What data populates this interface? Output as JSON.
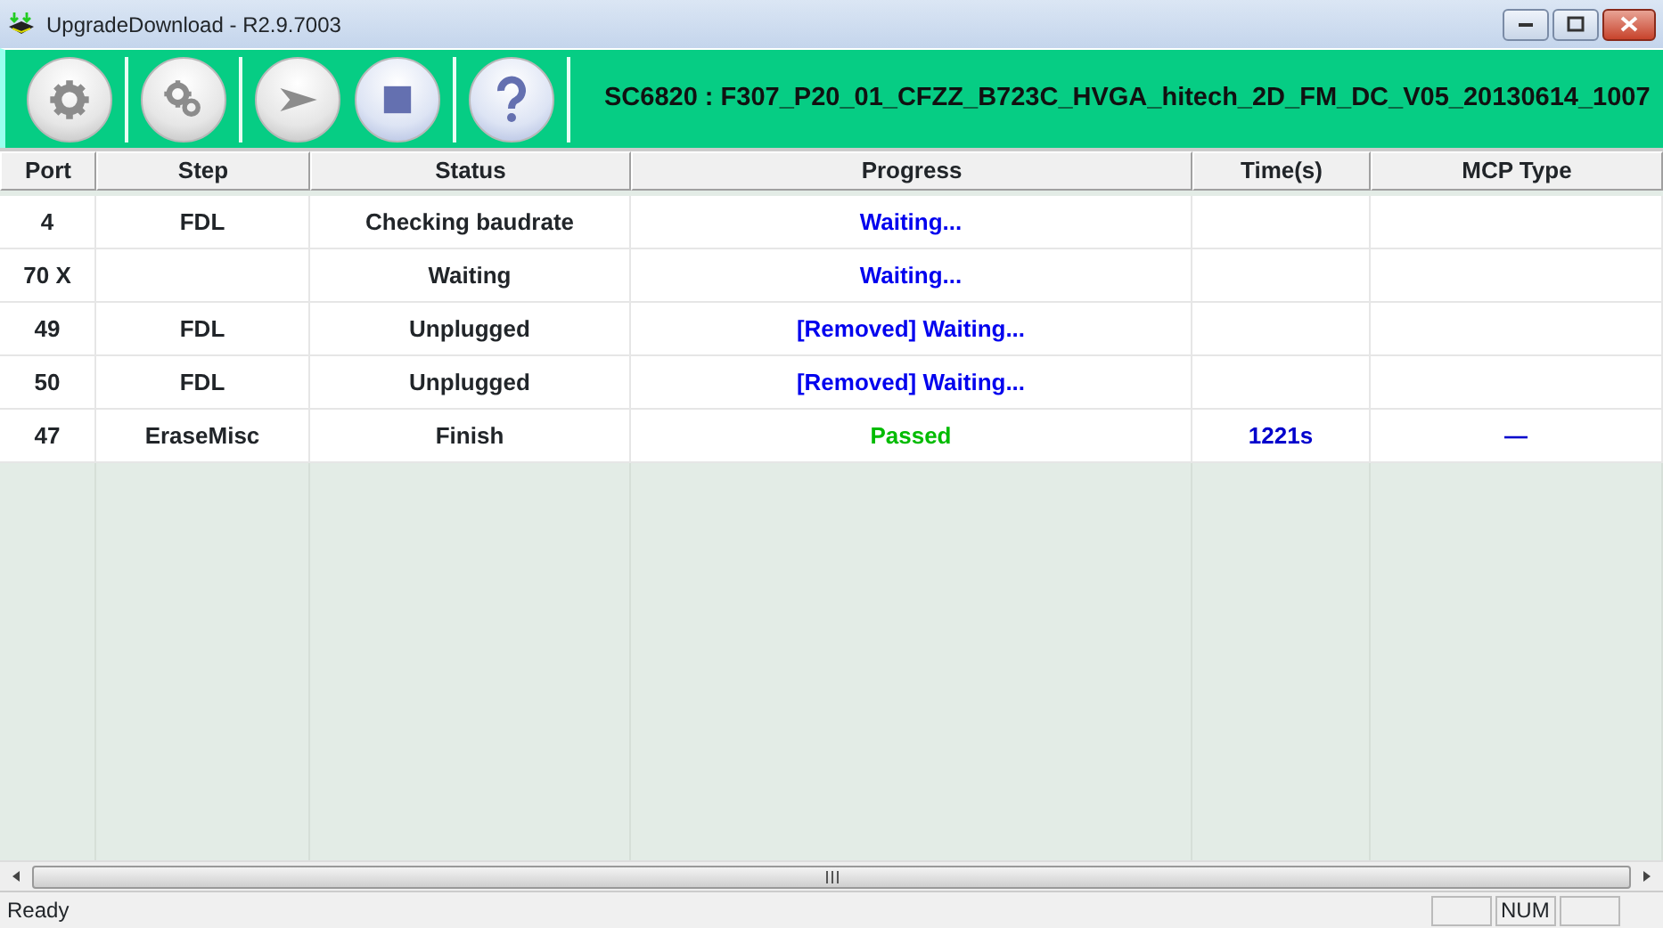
{
  "window": {
    "title": "UpgradeDownload - R2.9.7003"
  },
  "toolbar": {
    "buttons": [
      {
        "kind": "gear",
        "disabled": true
      },
      {
        "kind": "gears",
        "disabled": true
      },
      {
        "kind": "play",
        "disabled": true
      },
      {
        "kind": "stop",
        "disabled": false
      },
      {
        "kind": "help",
        "disabled": false
      }
    ],
    "firmware": "SC6820 : F307_P20_01_CFZZ_B723C_HVGA_hitech_2D_FM_DC_V05_20130614_1007"
  },
  "table": {
    "columns": [
      "Port",
      "Step",
      "Status",
      "Progress",
      "Time(s)",
      "MCP Type"
    ],
    "rows": [
      {
        "port": "4",
        "step": "FDL",
        "status": "Checking baudrate",
        "progress": {
          "text": "Waiting...",
          "color": "#0000ee"
        }
      },
      {
        "port": "70 X",
        "status": "Waiting",
        "progress": {
          "text": "Waiting...",
          "color": "#0000ee"
        }
      },
      {
        "port": "49",
        "step": "FDL",
        "status": "Unplugged",
        "progress": {
          "text": "[Removed] Waiting...",
          "color": "#0000ee"
        }
      },
      {
        "port": "50",
        "step": "FDL",
        "status": "Unplugged",
        "progress": {
          "text": "[Removed] Waiting...",
          "color": "#0000ee"
        }
      },
      {
        "port": "47",
        "step": "EraseMisc",
        "status": "Finish",
        "progress": {
          "text": "Passed",
          "color": "#00bb00"
        },
        "time": "1221s",
        "mcp": "—"
      }
    ]
  },
  "status_bar": {
    "text": "Ready",
    "indicator": "NUM"
  }
}
